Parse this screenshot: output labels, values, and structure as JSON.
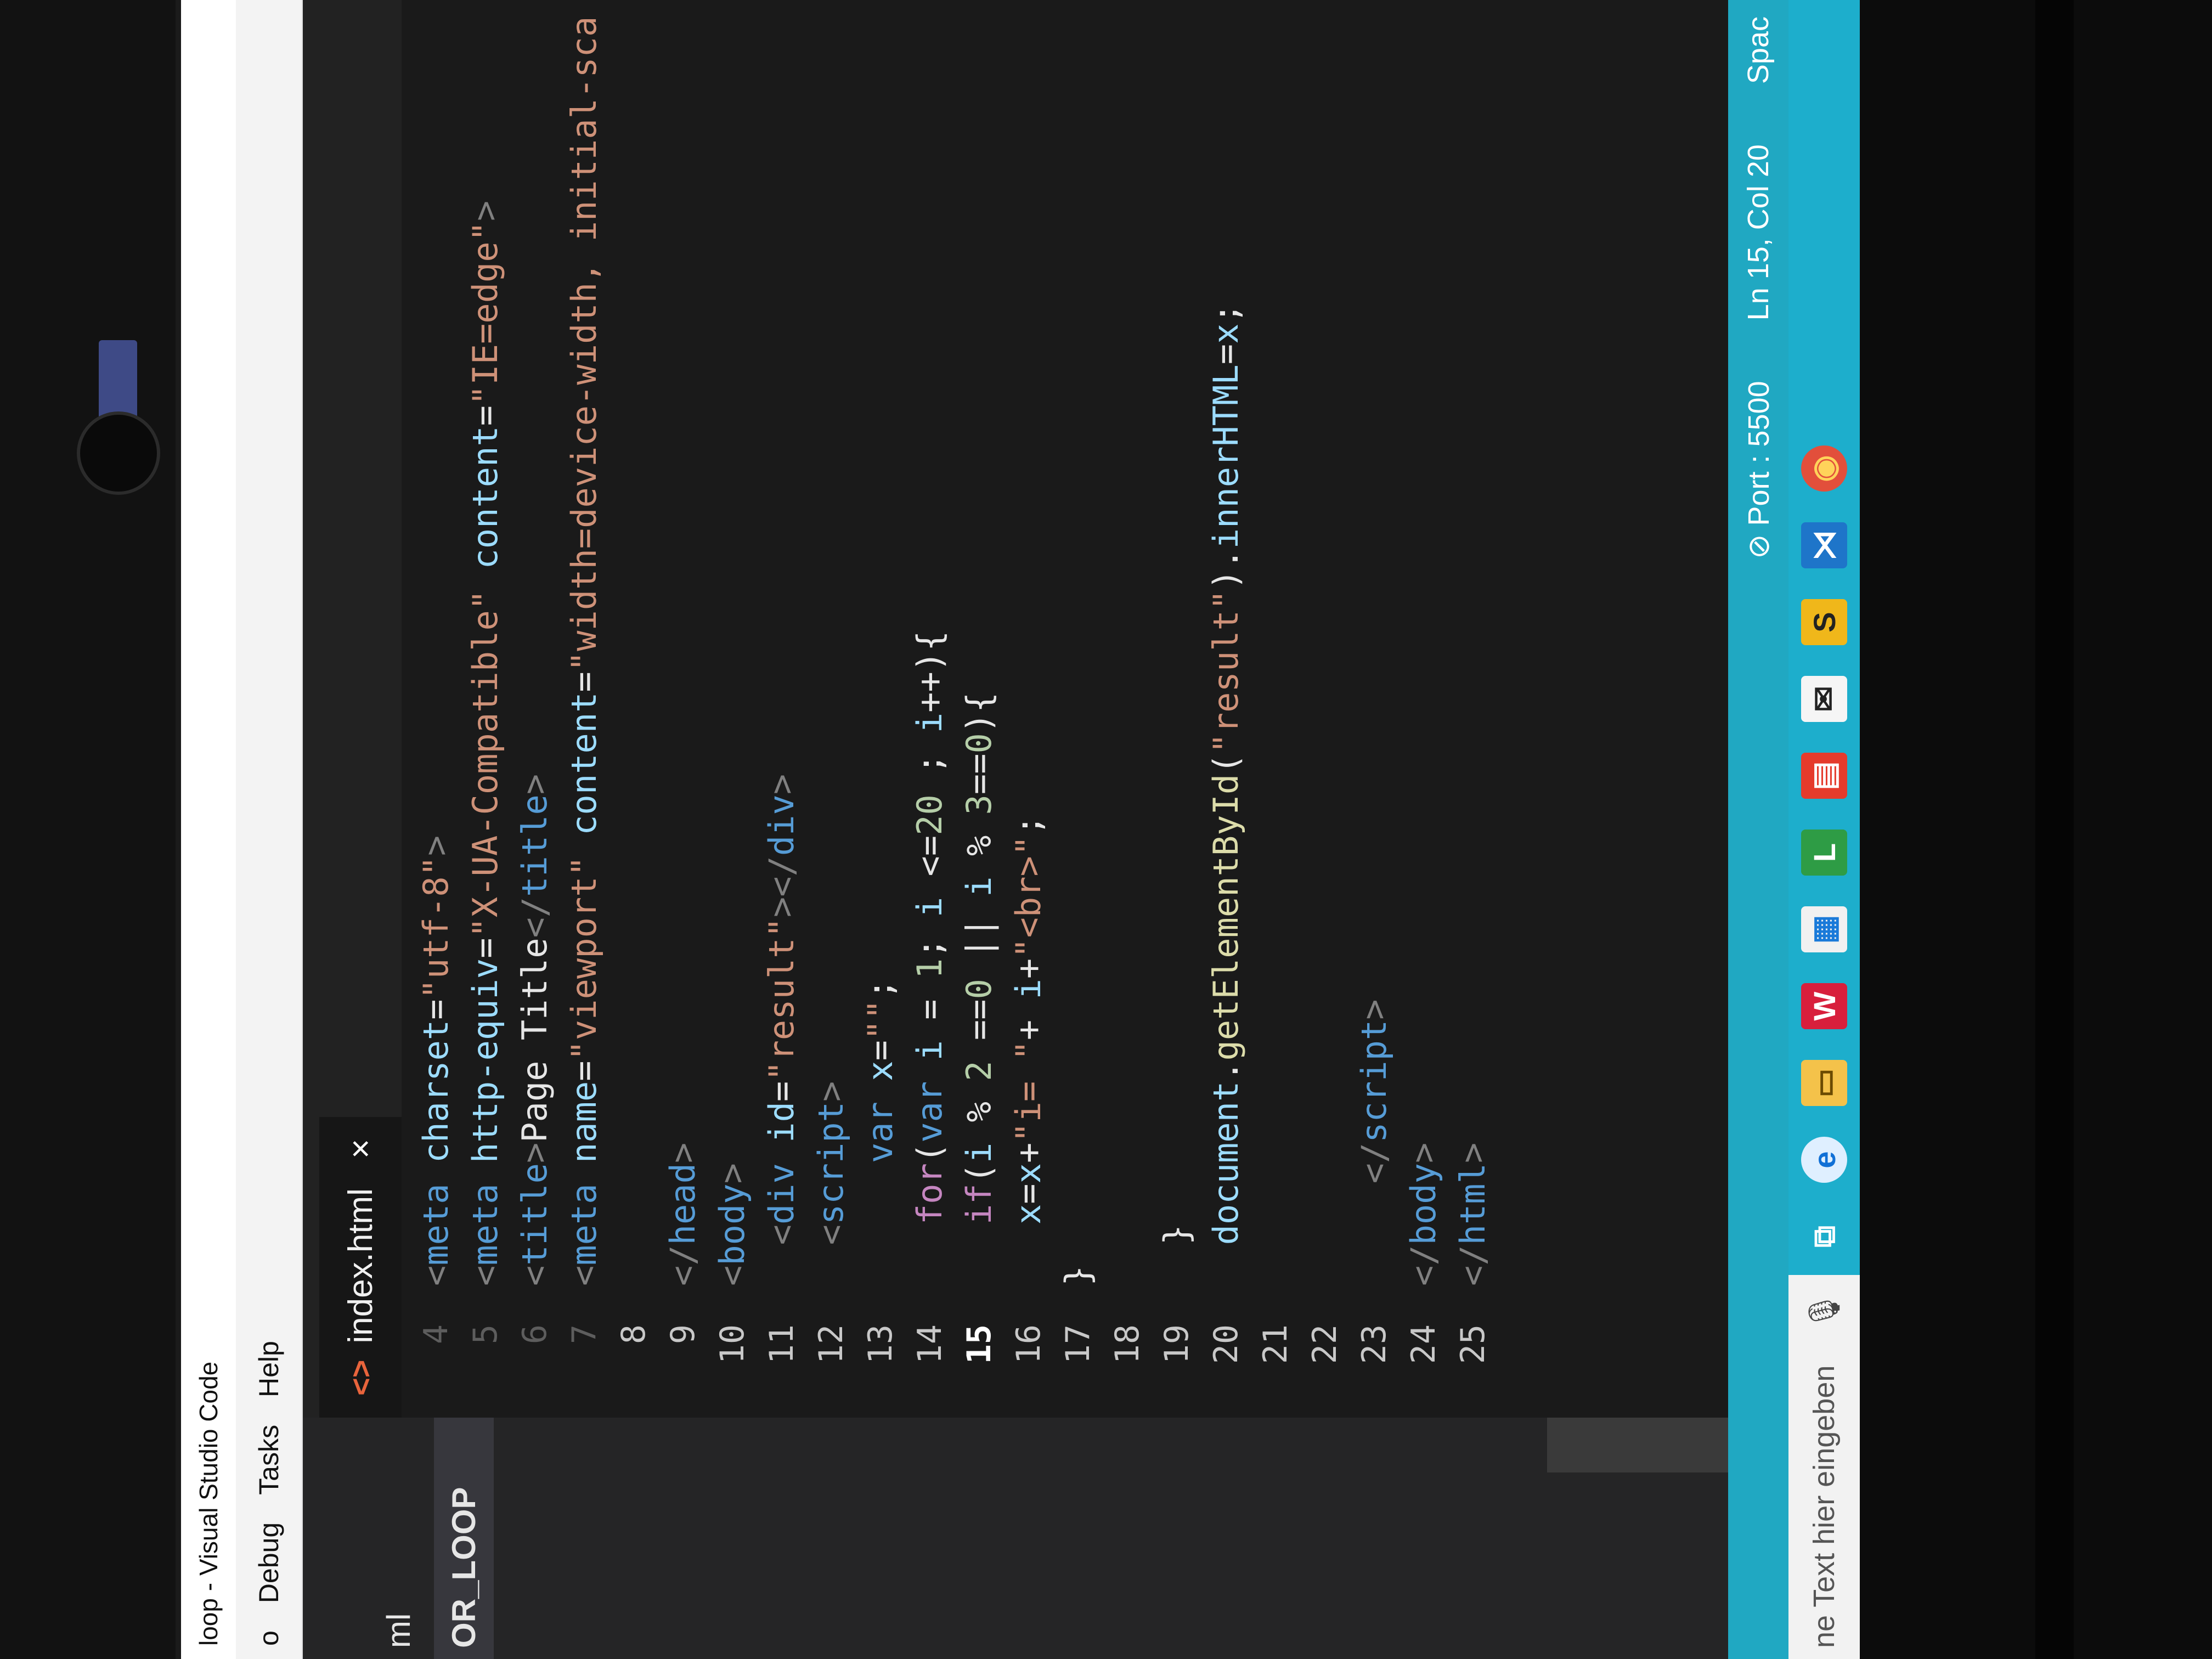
{
  "window": {
    "title": "loop - Visual Studio Code",
    "menu": [
      "o",
      "Debug",
      "Tasks",
      "Help"
    ]
  },
  "sidebar": {
    "file": "ml",
    "folder": "OR_LOOP"
  },
  "tab": {
    "icon": "<>",
    "label": "index.html",
    "close": "×"
  },
  "editor": {
    "active_line": "15",
    "lines": [
      {
        "n": "4",
        "tokens": [
          {
            "t": "<",
            "c": "punct"
          },
          {
            "t": "meta ",
            "c": "tag"
          },
          {
            "t": "charset",
            "c": "attr"
          },
          {
            "t": "=",
            "c": "op"
          },
          {
            "t": "\"utf-8\"",
            "c": "str"
          },
          {
            "t": ">",
            "c": "punct"
          }
        ]
      },
      {
        "n": "5",
        "tokens": [
          {
            "t": "<",
            "c": "punct"
          },
          {
            "t": "meta ",
            "c": "tag"
          },
          {
            "t": "http-equiv",
            "c": "attr"
          },
          {
            "t": "=",
            "c": "op"
          },
          {
            "t": "\"X-UA-Compatible\"",
            "c": "str"
          },
          {
            "t": " ",
            "c": "plain"
          },
          {
            "t": "content",
            "c": "attr"
          },
          {
            "t": "=",
            "c": "op"
          },
          {
            "t": "\"IE=edge\"",
            "c": "str"
          },
          {
            "t": ">",
            "c": "punct"
          }
        ]
      },
      {
        "n": "6",
        "tokens": [
          {
            "t": "<",
            "c": "punct"
          },
          {
            "t": "title",
            "c": "tag"
          },
          {
            "t": ">",
            "c": "punct"
          },
          {
            "t": "Page Title",
            "c": "text"
          },
          {
            "t": "</",
            "c": "punct"
          },
          {
            "t": "title",
            "c": "tag"
          },
          {
            "t": ">",
            "c": "punct"
          }
        ]
      },
      {
        "n": "7",
        "tokens": [
          {
            "t": "<",
            "c": "punct"
          },
          {
            "t": "meta ",
            "c": "tag"
          },
          {
            "t": "name",
            "c": "attr"
          },
          {
            "t": "=",
            "c": "op"
          },
          {
            "t": "\"viewport\"",
            "c": "str"
          },
          {
            "t": " ",
            "c": "plain"
          },
          {
            "t": "content",
            "c": "attr"
          },
          {
            "t": "=",
            "c": "op"
          },
          {
            "t": "\"width=device-width, initial-sca",
            "c": "str"
          }
        ]
      },
      {
        "n": "8",
        "tokens": []
      },
      {
        "n": "9",
        "tokens": [
          {
            "t": "</",
            "c": "punct"
          },
          {
            "t": "head",
            "c": "tag"
          },
          {
            "t": ">",
            "c": "punct"
          }
        ]
      },
      {
        "n": "10",
        "tokens": [
          {
            "t": "<",
            "c": "punct"
          },
          {
            "t": "body",
            "c": "tag"
          },
          {
            "t": ">",
            "c": "punct"
          }
        ]
      },
      {
        "n": "11",
        "tokens": [
          {
            "t": "  <",
            "c": "punct"
          },
          {
            "t": "div ",
            "c": "tag"
          },
          {
            "t": "id",
            "c": "attr"
          },
          {
            "t": "=",
            "c": "op"
          },
          {
            "t": "\"result\"",
            "c": "str"
          },
          {
            "t": "></",
            "c": "punct"
          },
          {
            "t": "div",
            "c": "tag"
          },
          {
            "t": ">",
            "c": "punct"
          }
        ]
      },
      {
        "n": "12",
        "tokens": [
          {
            "t": "  <",
            "c": "punct"
          },
          {
            "t": "script",
            "c": "tag"
          },
          {
            "t": ">",
            "c": "punct"
          }
        ]
      },
      {
        "n": "13",
        "tokens": [
          {
            "t": "      ",
            "c": "plain"
          },
          {
            "t": "var ",
            "c": "kw"
          },
          {
            "t": "x",
            "c": "var"
          },
          {
            "t": "=",
            "c": "op"
          },
          {
            "t": "\"\"",
            "c": "str"
          },
          {
            "t": ";",
            "c": "op"
          }
        ]
      },
      {
        "n": "14",
        "tokens": [
          {
            "t": "   ",
            "c": "plain"
          },
          {
            "t": "for",
            "c": "ctrl"
          },
          {
            "t": "(",
            "c": "op"
          },
          {
            "t": "var ",
            "c": "kw"
          },
          {
            "t": "i",
            "c": "var"
          },
          {
            "t": " = ",
            "c": "op"
          },
          {
            "t": "1",
            "c": "num"
          },
          {
            "t": "; ",
            "c": "op"
          },
          {
            "t": "i",
            "c": "var"
          },
          {
            "t": " <=",
            "c": "op"
          },
          {
            "t": "20",
            "c": "num"
          },
          {
            "t": " ; ",
            "c": "op"
          },
          {
            "t": "i",
            "c": "var"
          },
          {
            "t": "++){",
            "c": "op"
          }
        ]
      },
      {
        "n": "15",
        "tokens": [
          {
            "t": "   ",
            "c": "plain"
          },
          {
            "t": "if",
            "c": "ctrl"
          },
          {
            "t": "(",
            "c": "op"
          },
          {
            "t": "i",
            "c": "var"
          },
          {
            "t": " % ",
            "c": "op"
          },
          {
            "t": "2",
            "c": "num"
          },
          {
            "t": " ==",
            "c": "op"
          },
          {
            "t": "0",
            "c": "num"
          },
          {
            "t": " || ",
            "c": "op"
          },
          {
            "t": "i",
            "c": "var"
          },
          {
            "t": " % ",
            "c": "op"
          },
          {
            "t": "3",
            "c": "num"
          },
          {
            "t": "==",
            "c": "op"
          },
          {
            "t": "0",
            "c": "num"
          },
          {
            "t": "){",
            "c": "op"
          }
        ]
      },
      {
        "n": "16",
        "tokens": [
          {
            "t": "   ",
            "c": "plain"
          },
          {
            "t": "x",
            "c": "var"
          },
          {
            "t": "=",
            "c": "op"
          },
          {
            "t": "x",
            "c": "var"
          },
          {
            "t": "+",
            "c": "op"
          },
          {
            "t": "\"i= \"",
            "c": "str"
          },
          {
            "t": "+ ",
            "c": "op"
          },
          {
            "t": "i",
            "c": "var"
          },
          {
            "t": "+",
            "c": "op"
          },
          {
            "t": "\"<br>\"",
            "c": "str"
          },
          {
            "t": ";",
            "c": "op"
          }
        ]
      },
      {
        "n": "17",
        "tokens": [
          {
            "t": "}",
            "c": "plain"
          }
        ]
      },
      {
        "n": "18",
        "tokens": []
      },
      {
        "n": "19",
        "tokens": [
          {
            "t": "  }",
            "c": "plain"
          }
        ]
      },
      {
        "n": "20",
        "tokens": [
          {
            "t": "  ",
            "c": "plain"
          },
          {
            "t": "document",
            "c": "var"
          },
          {
            "t": ".",
            "c": "op"
          },
          {
            "t": "getElementById",
            "c": "fn"
          },
          {
            "t": "(",
            "c": "op"
          },
          {
            "t": "\"result\"",
            "c": "str"
          },
          {
            "t": ").",
            "c": "op"
          },
          {
            "t": "innerHTML",
            "c": "var"
          },
          {
            "t": "=",
            "c": "op"
          },
          {
            "t": "x",
            "c": "var"
          },
          {
            "t": ";",
            "c": "op"
          }
        ]
      },
      {
        "n": "21",
        "tokens": []
      },
      {
        "n": "22",
        "tokens": []
      },
      {
        "n": "23",
        "tokens": [
          {
            "t": "     </",
            "c": "punct"
          },
          {
            "t": "script",
            "c": "tag"
          },
          {
            "t": ">",
            "c": "punct"
          }
        ]
      },
      {
        "n": "24",
        "tokens": [
          {
            "t": "</",
            "c": "punct"
          },
          {
            "t": "body",
            "c": "tag"
          },
          {
            "t": ">",
            "c": "punct"
          }
        ]
      },
      {
        "n": "25",
        "tokens": [
          {
            "t": "</",
            "c": "punct"
          },
          {
            "t": "html",
            "c": "tag"
          },
          {
            "t": ">",
            "c": "punct"
          }
        ]
      }
    ]
  },
  "statusbar": {
    "port": "⊘ Port : 5500",
    "position": "Ln 15, Col 20",
    "spaces": "Spac"
  },
  "taskbar": {
    "search_placeholder": "ne Text hier eingeben",
    "icons": [
      {
        "name": "task-view-icon",
        "glyph": "⧉",
        "cls": ""
      },
      {
        "name": "edge-icon",
        "glyph": "e",
        "cls": "ti-edge"
      },
      {
        "name": "file-explorer-icon",
        "glyph": "▭",
        "cls": "ti-files"
      },
      {
        "name": "shield-app-icon",
        "glyph": "W",
        "cls": "ti-shield"
      },
      {
        "name": "store-icon",
        "glyph": "▦",
        "cls": "ti-store"
      },
      {
        "name": "green-app-icon",
        "glyph": "L",
        "cls": "ti-green"
      },
      {
        "name": "red-app-icon",
        "glyph": "▤",
        "cls": "ti-red"
      },
      {
        "name": "mail-icon",
        "glyph": "✉",
        "cls": "ti-mail"
      },
      {
        "name": "yellow-app-icon",
        "glyph": "S",
        "cls": "ti-yellow"
      },
      {
        "name": "vscode-icon",
        "glyph": "⋊",
        "cls": "ti-vscode"
      },
      {
        "name": "chrome-icon",
        "glyph": "◉",
        "cls": "ti-chrome"
      }
    ]
  },
  "colors": {
    "accent_statusbar": "#20a8c2",
    "taskbar": "#1daecc",
    "editor_bg": "#1a1a1a"
  }
}
